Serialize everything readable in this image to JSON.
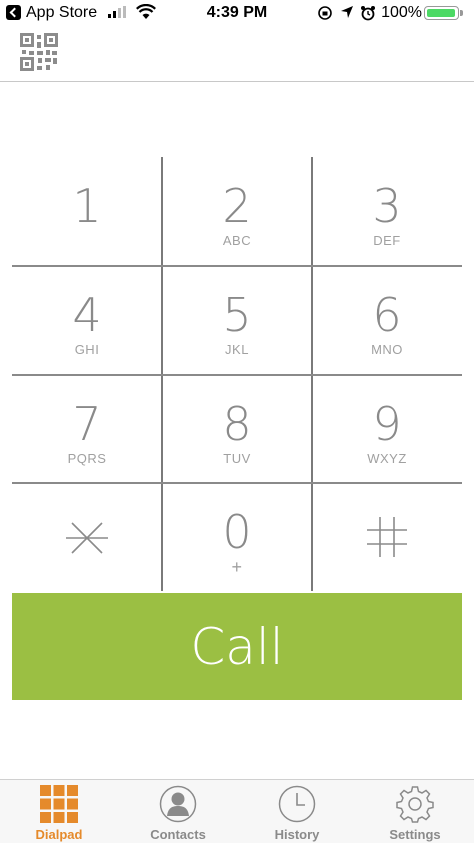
{
  "status_bar": {
    "back_label": "App Store",
    "time": "4:39 PM",
    "battery": "100%",
    "battery_level": 1.0
  },
  "keypad": {
    "keys": [
      {
        "digit": "1",
        "letters": ""
      },
      {
        "digit": "2",
        "letters": "ABC"
      },
      {
        "digit": "3",
        "letters": "DEF"
      },
      {
        "digit": "4",
        "letters": "GHI"
      },
      {
        "digit": "5",
        "letters": "JKL"
      },
      {
        "digit": "6",
        "letters": "MNO"
      },
      {
        "digit": "7",
        "letters": "PQRS"
      },
      {
        "digit": "8",
        "letters": "TUV"
      },
      {
        "digit": "9",
        "letters": "WXYZ"
      },
      {
        "digit": "*",
        "letters": ""
      },
      {
        "digit": "0",
        "letters": "+"
      },
      {
        "digit": "#",
        "letters": ""
      }
    ]
  },
  "call": {
    "label": "Call",
    "color": "#9bbf43"
  },
  "tabs": [
    {
      "label": "Dialpad",
      "icon": "dialpad-grid-icon",
      "active": true
    },
    {
      "label": "Contacts",
      "icon": "contact-person-icon",
      "active": false
    },
    {
      "label": "History",
      "icon": "clock-icon",
      "active": false
    },
    {
      "label": "Settings",
      "icon": "gear-icon",
      "active": false
    }
  ],
  "colors": {
    "accent": "#e58a2b",
    "key_text": "#8a8a8a",
    "grid_lines": "#7a7a7a"
  }
}
